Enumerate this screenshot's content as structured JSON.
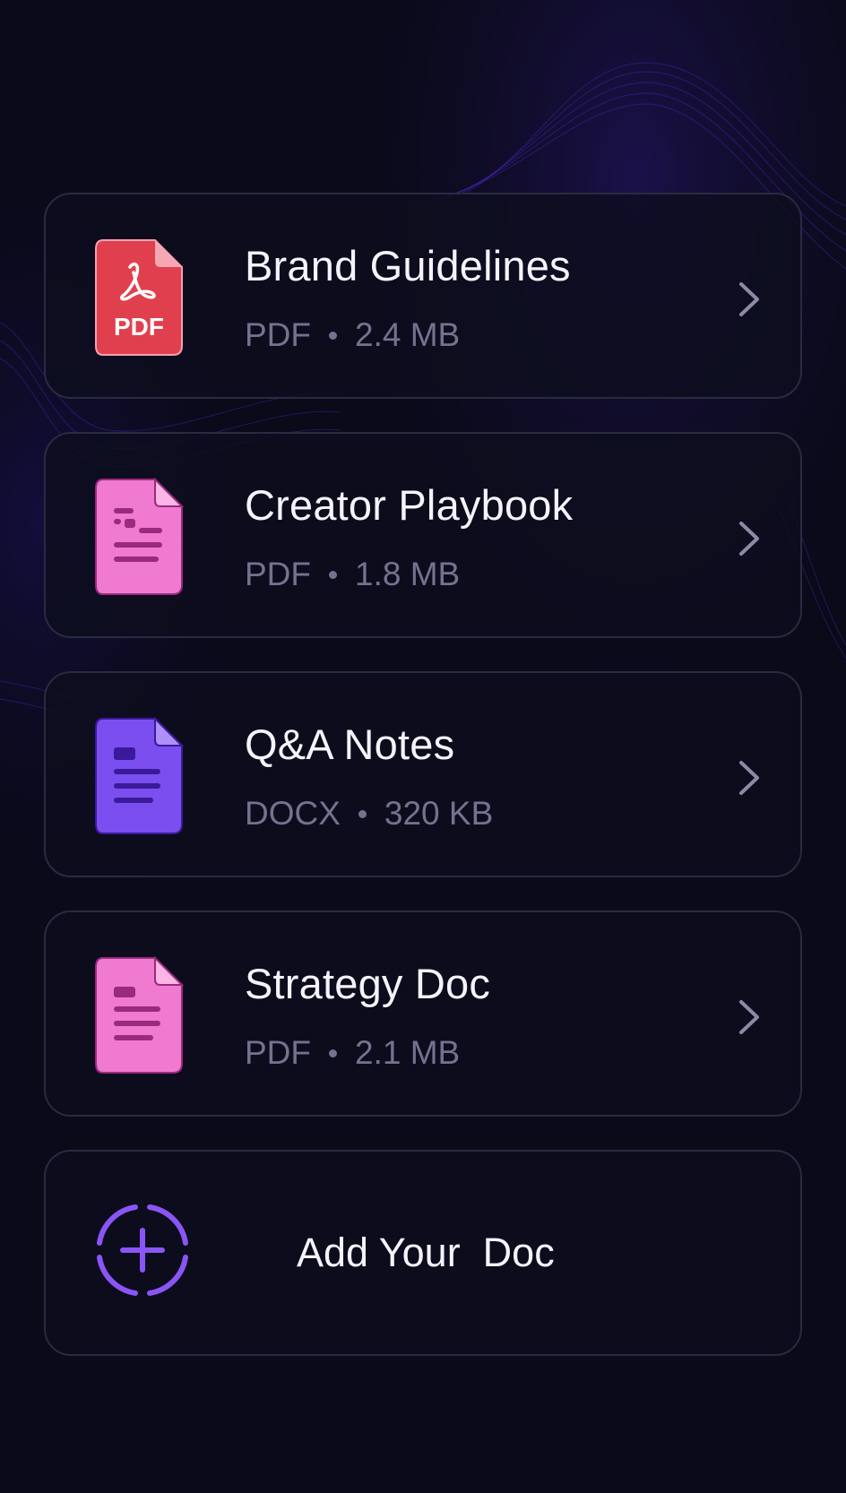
{
  "documents": [
    {
      "title": "Brand Guidelines",
      "type": "PDF",
      "size": "2.4 MB",
      "icon": "pdf-file-icon",
      "icon_label": "PDF",
      "color": "#e0404e"
    },
    {
      "title": "Creator Playbook",
      "type": "PDF",
      "size": "1.8 MB",
      "icon": "document-file-icon",
      "color": "#f07ad0"
    },
    {
      "title": "Q&A Notes",
      "type": "DOCX",
      "size": "320 KB",
      "icon": "document-file-icon",
      "color": "#7b4ef0"
    },
    {
      "title": "Strategy Doc",
      "type": "PDF",
      "size": "2.1 MB",
      "icon": "document-file-icon",
      "color": "#f07ad0"
    }
  ],
  "add_doc": {
    "label": "Add Your  Doc",
    "icon": "add-circle-icon",
    "color": "#8a55f5"
  },
  "theme": {
    "background": "#0a0a18",
    "card_border": "#2a2a40",
    "accent": "#5a2ee0"
  }
}
